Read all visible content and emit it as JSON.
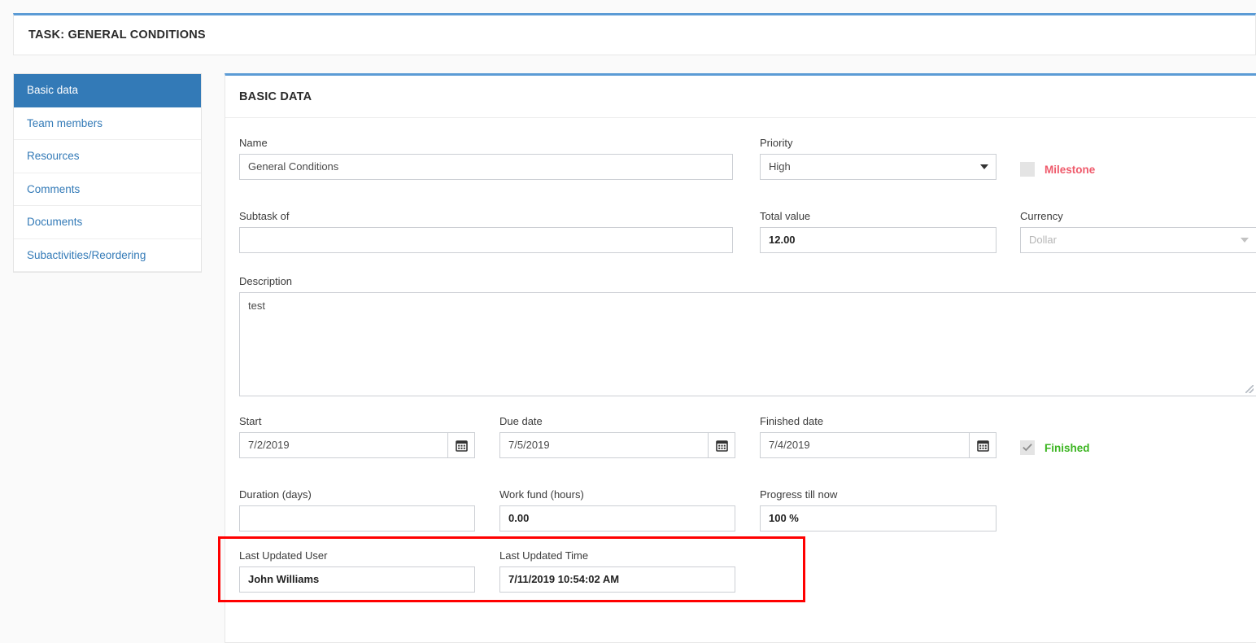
{
  "header": {
    "title": "TASK: GENERAL CONDITIONS"
  },
  "sidebar": {
    "items": [
      {
        "label": "Basic data",
        "active": true
      },
      {
        "label": "Team members",
        "active": false
      },
      {
        "label": "Resources",
        "active": false
      },
      {
        "label": "Comments",
        "active": false
      },
      {
        "label": "Documents",
        "active": false
      },
      {
        "label": "Subactivities/Reordering",
        "active": false
      }
    ]
  },
  "panel": {
    "heading": "BASIC DATA"
  },
  "form": {
    "name": {
      "label": "Name",
      "value": "General Conditions"
    },
    "priority": {
      "label": "Priority",
      "value": "High",
      "options": [
        "High"
      ]
    },
    "milestone": {
      "label": "Milestone",
      "checked": false,
      "color": "#ef5a6b"
    },
    "subtask_of": {
      "label": "Subtask of",
      "value": ""
    },
    "total_value": {
      "label": "Total value",
      "value": "12.00"
    },
    "currency": {
      "label": "Currency",
      "value": "Dollar",
      "disabled": true,
      "options": [
        "Dollar"
      ]
    },
    "description": {
      "label": "Description",
      "value": "test"
    },
    "start": {
      "label": "Start",
      "value": "7/2/2019"
    },
    "due_date": {
      "label": "Due date",
      "value": "7/5/2019"
    },
    "finished_date": {
      "label": "Finished date",
      "value": "7/4/2019"
    },
    "finished": {
      "label": "Finished",
      "checked": true,
      "color": "#3cb521"
    },
    "duration_days": {
      "label": "Duration (days)",
      "value": ""
    },
    "work_fund_hours": {
      "label": "Work fund (hours)",
      "value": "0.00"
    },
    "progress_till_now": {
      "label": "Progress till now",
      "value": "100 %"
    },
    "last_updated_user": {
      "label": "Last Updated User",
      "value": "John Williams"
    },
    "last_updated_time": {
      "label": "Last Updated Time",
      "value": "7/11/2019 10:54:02 AM"
    }
  },
  "icons": {
    "calendar": "calendar-icon",
    "caret_down": "chevron-down-icon",
    "checkmark": "check-icon"
  },
  "theme": {
    "accent_blue": "#337ab7",
    "panel_top_border": "#5b9bd5",
    "highlight_red": "#ff0000",
    "milestone_red": "#ef5a6b",
    "finished_green": "#3cb521"
  }
}
